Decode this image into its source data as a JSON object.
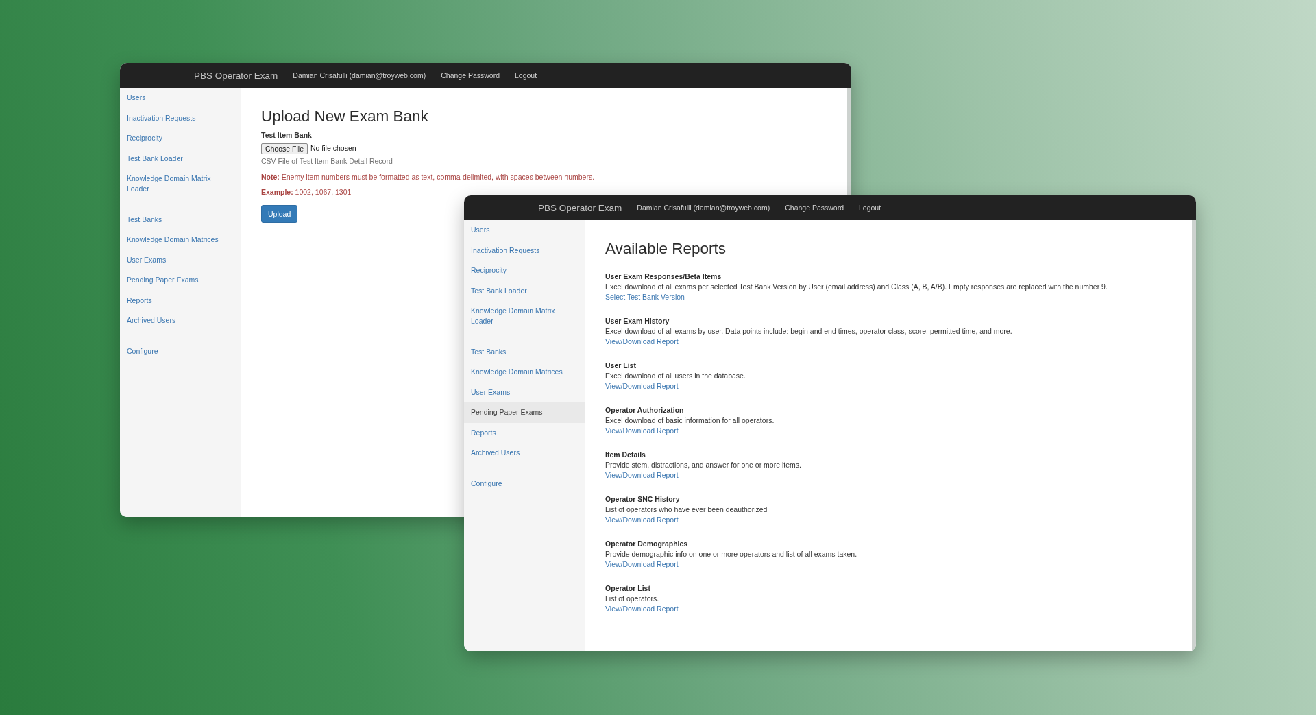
{
  "windows": [
    {
      "navbar": {
        "brand": "PBS Operator Exam",
        "links": [
          "Damian Crisafulli (damian@troyweb.com)",
          "Change Password",
          "Logout"
        ]
      },
      "sidebar": {
        "groups": [
          {
            "items": [
              {
                "label": "Users",
                "selected": false
              },
              {
                "label": "Inactivation Requests",
                "selected": false
              },
              {
                "label": "Reciprocity",
                "selected": false
              },
              {
                "label": "Test Bank Loader",
                "selected": false
              },
              {
                "label": "Knowledge Domain Matrix Loader",
                "selected": false
              }
            ]
          },
          {
            "items": [
              {
                "label": "Test Banks",
                "selected": false
              },
              {
                "label": "Knowledge Domain Matrices",
                "selected": false
              },
              {
                "label": "User Exams",
                "selected": false
              },
              {
                "label": "Pending Paper Exams",
                "selected": false
              },
              {
                "label": "Reports",
                "selected": false
              },
              {
                "label": "Archived Users",
                "selected": false
              }
            ]
          },
          {
            "items": [
              {
                "label": "Configure",
                "selected": false
              }
            ]
          }
        ]
      },
      "page": {
        "kind": "upload",
        "title": "Upload New Exam Bank",
        "field_label": "Test Item Bank",
        "file_button": "Choose File",
        "file_status": "No file chosen",
        "help": "CSV File of Test Item Bank Detail Record",
        "note": "**Note:** Enemy item numbers must be formatted as text, comma-delimited, with spaces between numbers.",
        "example": "**Example:** 1002, 1067, 1301",
        "submit": "Upload"
      }
    },
    {
      "navbar": {
        "brand": "PBS Operator Exam",
        "links": [
          "Damian Crisafulli (damian@troyweb.com)",
          "Change Password",
          "Logout"
        ]
      },
      "sidebar": {
        "groups": [
          {
            "items": [
              {
                "label": "Users",
                "selected": false
              },
              {
                "label": "Inactivation Requests",
                "selected": false
              },
              {
                "label": "Reciprocity",
                "selected": false
              },
              {
                "label": "Test Bank Loader",
                "selected": false
              },
              {
                "label": "Knowledge Domain Matrix Loader",
                "selected": false
              }
            ]
          },
          {
            "items": [
              {
                "label": "Test Banks",
                "selected": false
              },
              {
                "label": "Knowledge Domain Matrices",
                "selected": false
              },
              {
                "label": "User Exams",
                "selected": false
              },
              {
                "label": "Pending Paper Exams",
                "selected": true
              },
              {
                "label": "Reports",
                "selected": false
              },
              {
                "label": "Archived Users",
                "selected": false
              }
            ]
          },
          {
            "items": [
              {
                "label": "Configure",
                "selected": false
              }
            ]
          }
        ]
      },
      "page": {
        "kind": "reports",
        "title": "Available Reports",
        "reports": [
          {
            "title": "User Exam Responses/Beta Items",
            "description": "Excel download of all exams per selected Test Bank Version by User (email address) and Class (A, B, A/B). Empty responses are replaced with the number 9.",
            "link": "Select Test Bank Version"
          },
          {
            "title": "User Exam History",
            "description": "Excel download of all exams by user. Data points include: begin and end times, operator class, score, permitted time, and more.",
            "link": "View/Download Report"
          },
          {
            "title": "User List",
            "description": "Excel download of all users in the database.",
            "link": "View/Download Report"
          },
          {
            "title": "Operator Authorization",
            "description": "Excel download of basic information for all operators.",
            "link": "View/Download Report"
          },
          {
            "title": "Item Details",
            "description": "Provide stem, distractions, and answer for one or more items.",
            "link": "View/Download Report"
          },
          {
            "title": "Operator SNC History",
            "description": "List of operators who have ever been deauthorized",
            "link": "View/Download Report"
          },
          {
            "title": "Operator Demographics",
            "description": "Provide demographic info on one or more operators and list of all exams taken.",
            "link": "View/Download Report"
          },
          {
            "title": "Operator List",
            "description": "List of operators.",
            "link": "View/Download Report"
          }
        ]
      }
    }
  ]
}
